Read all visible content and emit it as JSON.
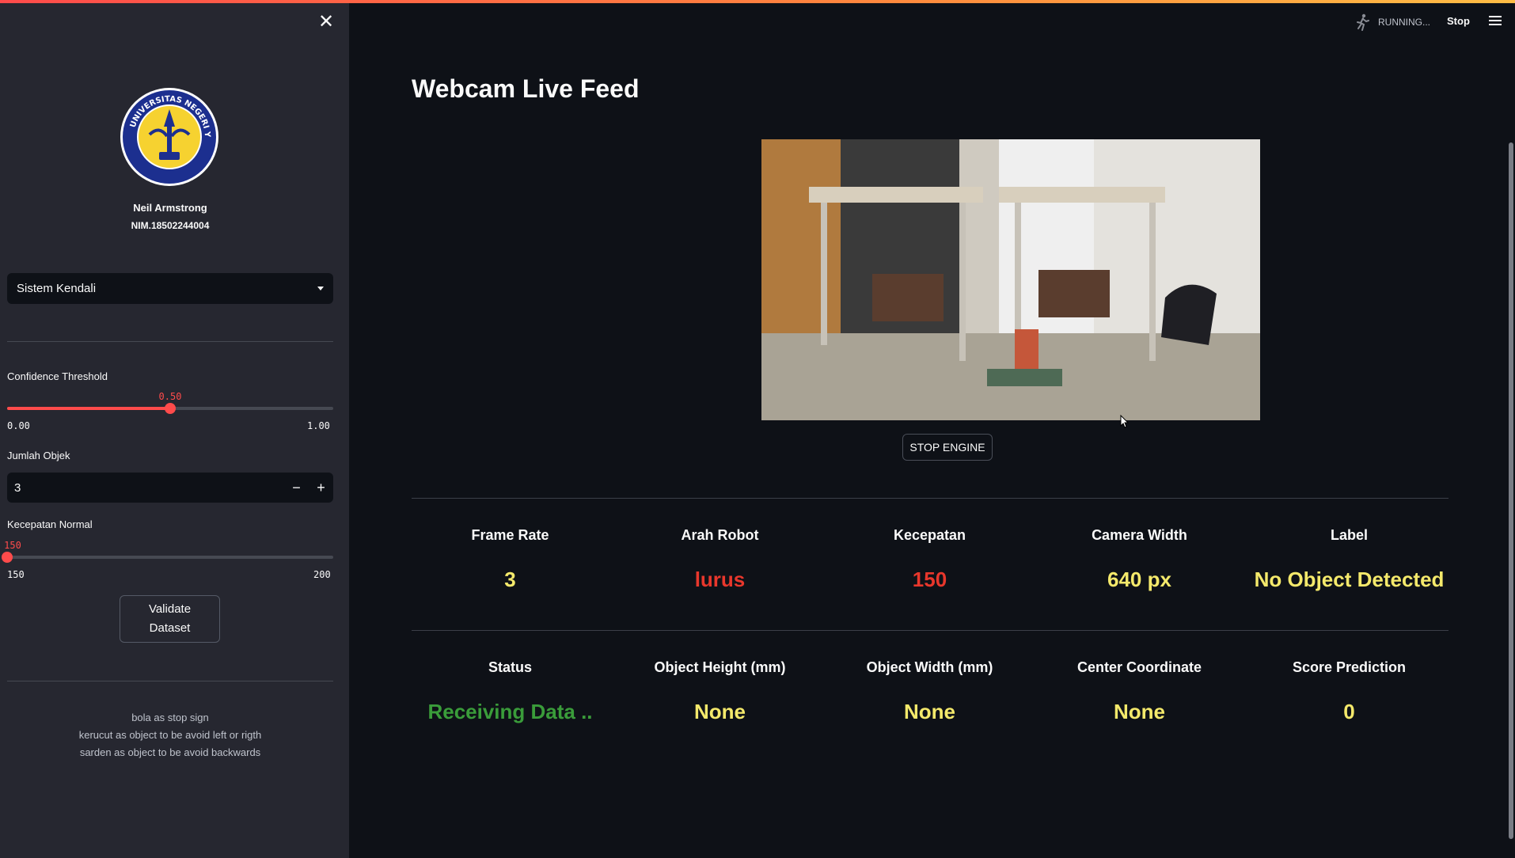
{
  "header": {
    "status_text": "RUNNING...",
    "stop_label": "Stop"
  },
  "sidebar": {
    "close_symbol": "✕",
    "user": {
      "name": "Neil Armstrong",
      "nim": "NIM.18502244004"
    },
    "logo_text": "UNIVERSITAS NEGERI YOGYAKARTA",
    "select": {
      "selected": "Sistem Kendali"
    },
    "confidence": {
      "label": "Confidence Threshold",
      "value": "0.50",
      "min": "0.00",
      "max": "1.00",
      "fraction": 0.5
    },
    "jumlah_objek": {
      "label": "Jumlah Objek",
      "value": "3",
      "minus": "−",
      "plus": "+"
    },
    "kecepatan": {
      "label": "Kecepatan Normal",
      "value": "150",
      "min": "150",
      "max": "200",
      "fraction": 0
    },
    "validate_label_line1": "Validate",
    "validate_label_line2": "Dataset",
    "notes": [
      "bola as stop sign",
      "kerucut as object to be avoid left or rigth",
      "sarden as object to be avoid backwards"
    ]
  },
  "main": {
    "title": "Webcam Live Feed",
    "stop_engine_label": "STOP ENGINE",
    "metrics_row1": [
      {
        "label": "Frame Rate",
        "value": "3",
        "color": "#f4e96b"
      },
      {
        "label": "Arah Robot",
        "value": "lurus",
        "color": "#e8372c"
      },
      {
        "label": "Kecepatan",
        "value": "150",
        "color": "#e8372c"
      },
      {
        "label": "Camera Width",
        "value": "640 px",
        "color": "#f4e96b"
      },
      {
        "label": "Label",
        "value": "No Object Detected",
        "color": "#f4e96b"
      }
    ],
    "metrics_row2": [
      {
        "label": "Status",
        "value": "Receiving Data ..",
        "color": "#3a9c3a"
      },
      {
        "label": "Object Height (mm)",
        "value": "None",
        "color": "#f4e96b"
      },
      {
        "label": "Object Width (mm)",
        "value": "None",
        "color": "#f4e96b"
      },
      {
        "label": "Center Coordinate",
        "value": "None",
        "color": "#f4e96b"
      },
      {
        "label": "Score Prediction",
        "value": "0",
        "color": "#f4e96b"
      }
    ]
  },
  "colors": {
    "accent": "#ff4b4b",
    "sidebar_bg": "#262730",
    "main_bg": "#0e1117"
  }
}
